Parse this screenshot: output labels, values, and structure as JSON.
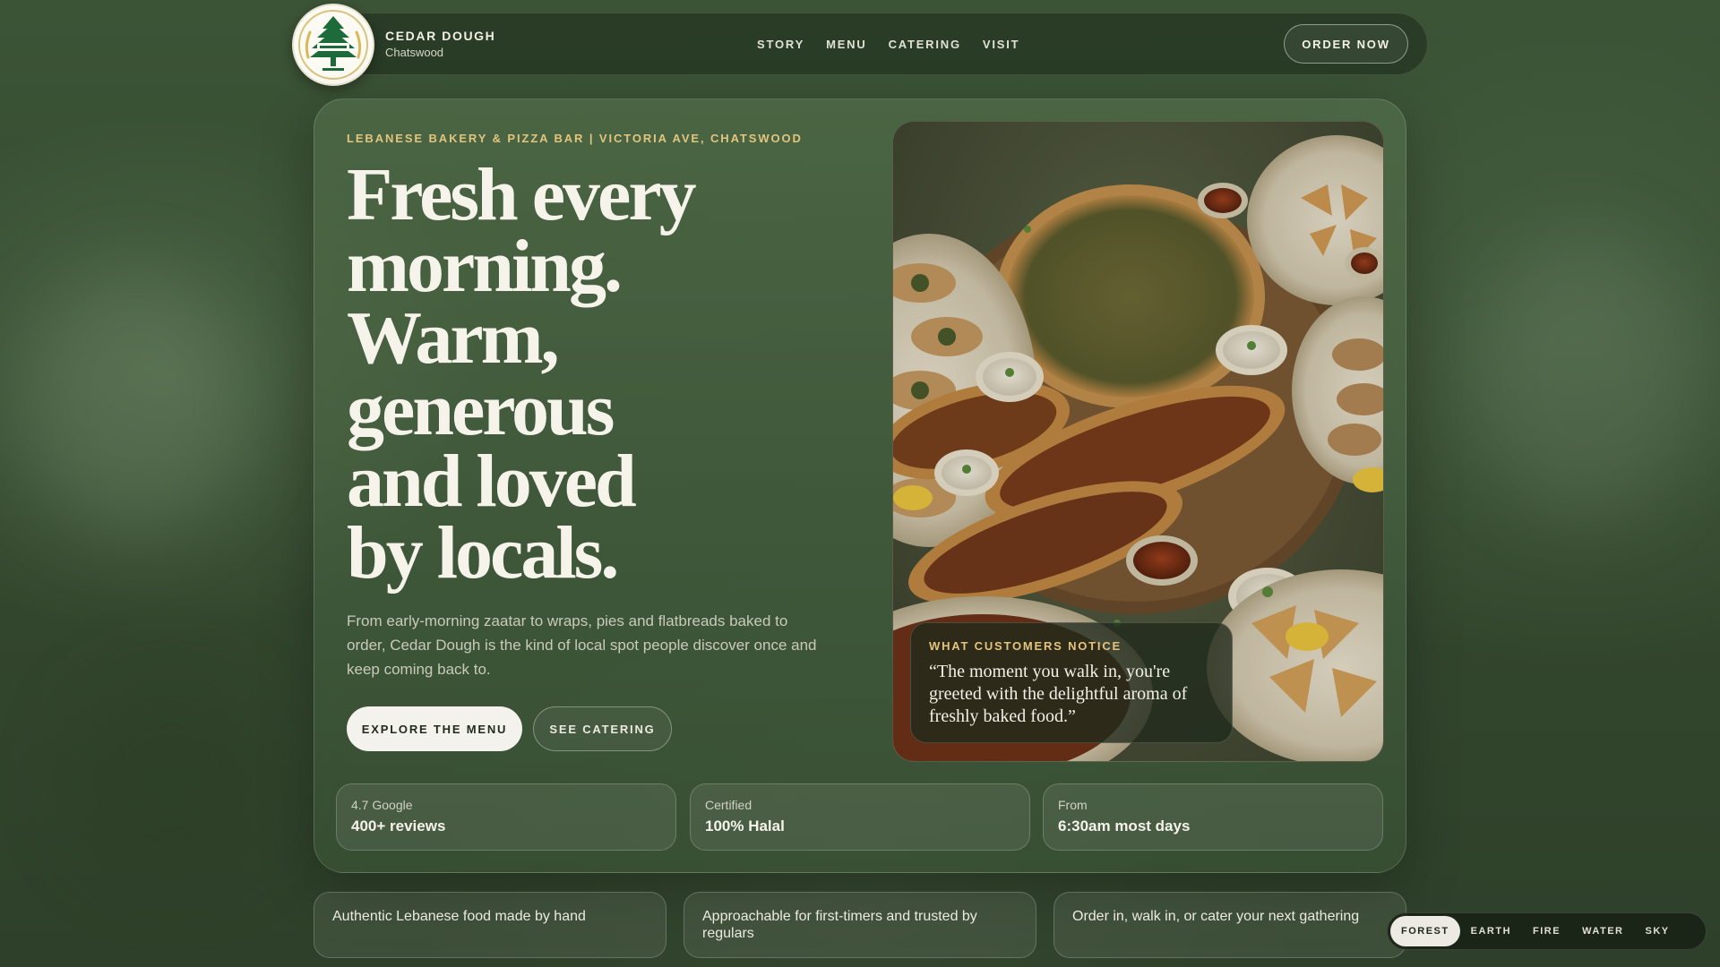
{
  "brand": {
    "name": "CEDAR DOUGH",
    "location": "Chatswood"
  },
  "nav": {
    "links": [
      "STORY",
      "MENU",
      "CATERING",
      "VISIT"
    ],
    "cta": "ORDER NOW"
  },
  "hero": {
    "eyebrow": "LEBANESE BAKERY & PIZZA BAR | VICTORIA AVE, CHATSWOOD",
    "headline_lines": [
      "Fresh every",
      "morning.",
      "Warm,",
      "generous",
      "and loved",
      "by locals."
    ],
    "lead": "From early-morning zaatar to wraps, pies and flatbreads baked to order, Cedar Dough is the kind of local spot people discover once and keep coming back to.",
    "primary_cta": "EXPLORE THE MENU",
    "secondary_cta": "SEE CATERING"
  },
  "quote": {
    "label": "WHAT CUSTOMERS NOTICE",
    "text": "“The moment you walk in, you're greeted with the delightful aroma of freshly baked food.”"
  },
  "stats": [
    {
      "label": "4.7 Google",
      "value": "400+ reviews"
    },
    {
      "label": "Certified",
      "value": "100% Halal"
    },
    {
      "label": "From",
      "value": "6:30am most days"
    }
  ],
  "features": [
    "Authentic Lebanese food made by hand",
    "Approachable for first-timers and trusted by regulars",
    "Order in, walk in, or cater your next gathering"
  ],
  "themes": {
    "options": [
      "FOREST",
      "EARTH",
      "FIRE",
      "WATER",
      "SKY"
    ],
    "active": "FOREST"
  },
  "colors": {
    "accent_gold": "#e3c47c",
    "background_green": "#3c5436",
    "logo_green": "#1d6b3a",
    "text_cream": "#f6f3ea"
  },
  "icons": {
    "logo": "cedar-tree-icon"
  }
}
